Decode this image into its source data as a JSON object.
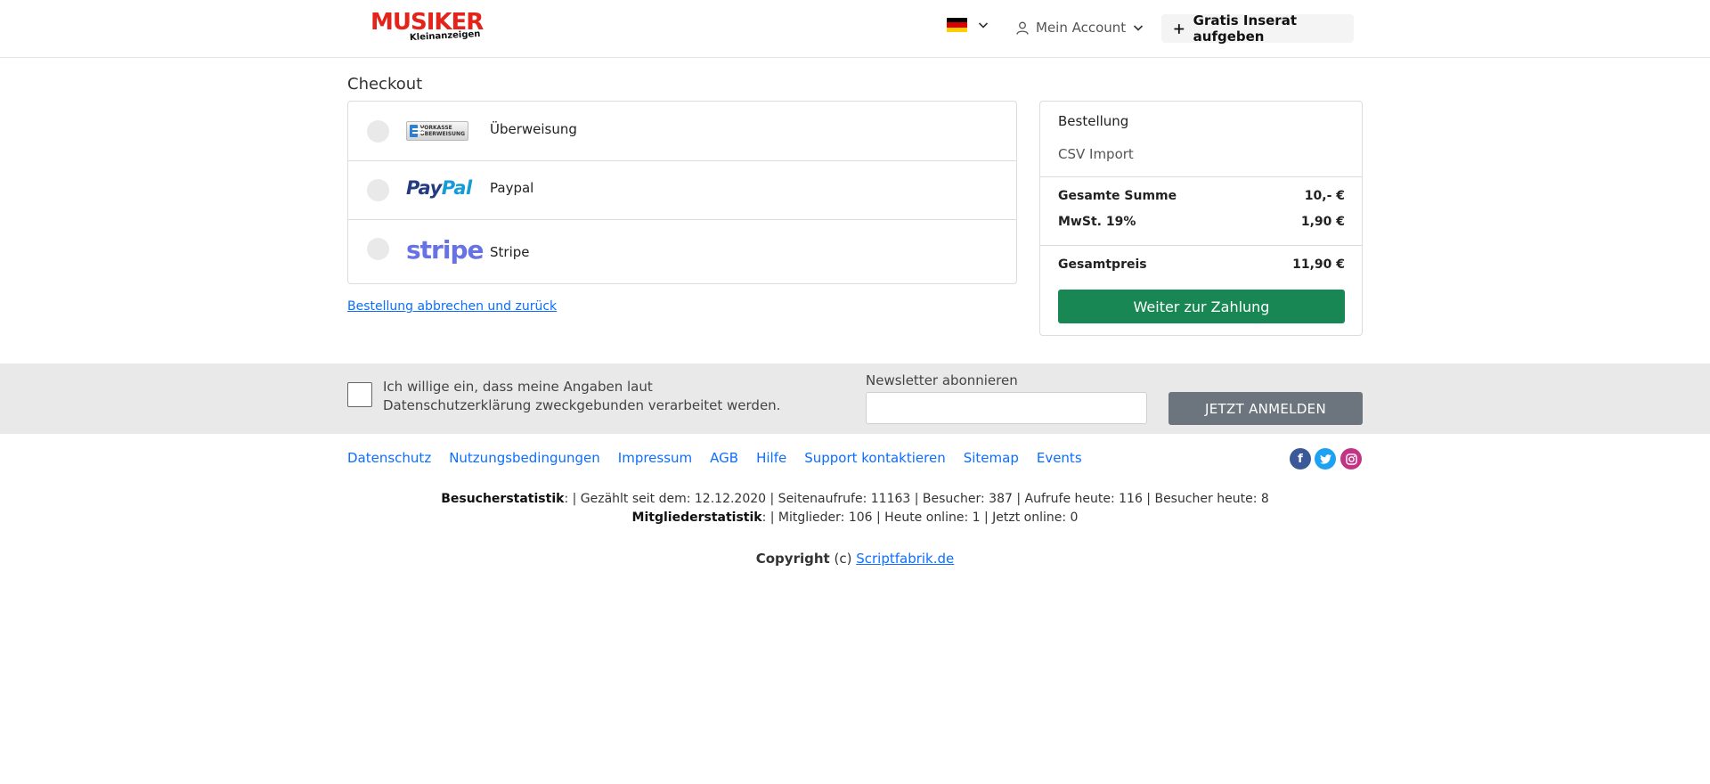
{
  "header": {
    "logo_main": "MUSIKER",
    "logo_sub": "Kleinanzeigen",
    "account_label": "Mein Account",
    "post_ad_label": "Gratis Inserat aufgeben"
  },
  "checkout": {
    "title": "Checkout",
    "methods": [
      {
        "label": "Überweisung",
        "logo_text": "VORKASSE ÜBERWEISUNG"
      },
      {
        "label": "Paypal",
        "logo_text_1": "Pay",
        "logo_text_2": "Pal"
      },
      {
        "label": "Stripe",
        "logo_text": "stripe"
      }
    ],
    "cancel_link": "Bestellung abbrechen und zurück"
  },
  "order": {
    "heading": "Bestellung",
    "item": "CSV Import",
    "total_label": "Gesamte Summe",
    "total_value": "10,- €",
    "vat_label": "MwSt. 19%",
    "vat_value": "1,90 €",
    "grand_label": "Gesamtpreis",
    "grand_value": "11,90 €",
    "pay_button": "Weiter zur Zahlung"
  },
  "newsletter": {
    "consent_text": "Ich willige ein, dass meine Angaben laut Datenschutzerklärung zweckgebunden verarbeitet werden.",
    "label": "Newsletter abonnieren",
    "input_value": "",
    "button": "JETZT ANMELDEN"
  },
  "footer": {
    "links": [
      "Datenschutz",
      "Nutzungsbedingungen",
      "Impressum",
      "AGB",
      "Hilfe",
      "Support kontaktieren",
      "Sitemap",
      "Events"
    ],
    "visitor_label": "Besucherstatistik",
    "visitor_text": ": |  Gezählt seit dem: 12.12.2020 | Seitenaufrufe: 11163 | Besucher: 387 | Aufrufe heute: 116 | Besucher heute: 8",
    "member_label": "Mitgliederstatistik",
    "member_text": ": |  Mitglieder: 106 | Heute online: 1 | Jetzt online: 0",
    "copyright_label": "Copyright",
    "copyright_c": "(c)",
    "copyright_link": "Scriptfabrik.de"
  },
  "colors": {
    "brand_red": "#e4231b",
    "pay_green": "#198754",
    "link_blue": "#0d6efd",
    "button_gray": "#6c757d",
    "facebook": "#3b5998",
    "twitter": "#1da1f2",
    "instagram": "#c13584"
  }
}
